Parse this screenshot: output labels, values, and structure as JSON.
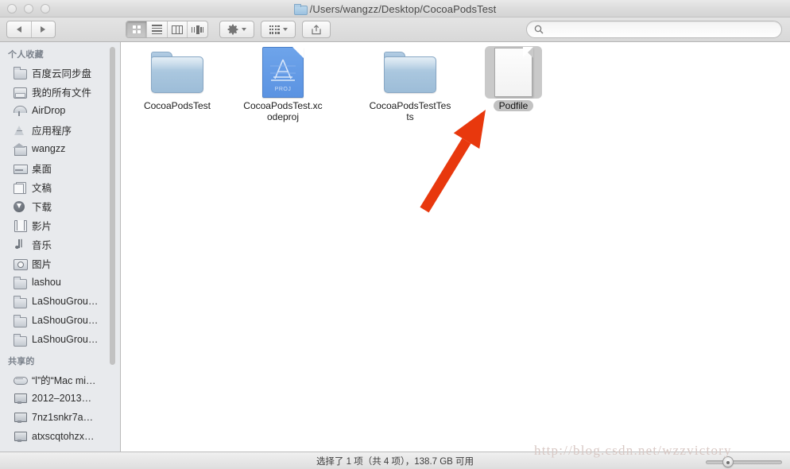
{
  "window": {
    "title": "/Users/wangzz/Desktop/CocoaPodsTest",
    "controls": {
      "close": "close-button",
      "minimize": "minimize-button",
      "maximize": "maximize-button"
    }
  },
  "toolbar": {
    "back_label": "◀",
    "forward_label": "▶",
    "view_modes": [
      {
        "name": "icon-view",
        "active": true
      },
      {
        "name": "list-view",
        "active": false
      },
      {
        "name": "column-view",
        "active": false
      },
      {
        "name": "coverflow-view",
        "active": false
      }
    ],
    "action_button": "gear-icon",
    "arrange_button": "arrange-icon",
    "share_button": "share-icon"
  },
  "search": {
    "value": "",
    "placeholder": "",
    "icon": "search-icon"
  },
  "sidebar": {
    "groups": [
      {
        "title": "个人收藏",
        "items": [
          {
            "label": "百度云同步盘",
            "icon": "folder-icon"
          },
          {
            "label": "我的所有文件",
            "icon": "all-files-icon"
          },
          {
            "label": "AirDrop",
            "icon": "airdrop-icon"
          },
          {
            "label": "应用程序",
            "icon": "applications-icon"
          },
          {
            "label": "wangzz",
            "icon": "home-icon"
          },
          {
            "label": "桌面",
            "icon": "desktop-icon"
          },
          {
            "label": "文稿",
            "icon": "documents-icon"
          },
          {
            "label": "下载",
            "icon": "downloads-icon"
          },
          {
            "label": "影片",
            "icon": "movies-icon"
          },
          {
            "label": "音乐",
            "icon": "music-icon"
          },
          {
            "label": "图片",
            "icon": "pictures-icon"
          },
          {
            "label": "lashou",
            "icon": "folder-icon"
          },
          {
            "label": "LaShouGrou…",
            "icon": "folder-icon"
          },
          {
            "label": "LaShouGrou…",
            "icon": "folder-icon"
          },
          {
            "label": "LaShouGrou…",
            "icon": "folder-icon"
          }
        ]
      },
      {
        "title": "共享的",
        "items": [
          {
            "label": "“l”的“Mac mi…",
            "icon": "mac-mini-icon"
          },
          {
            "label": "2012–2013…",
            "icon": "screen-icon"
          },
          {
            "label": "7nz1snkr7a…",
            "icon": "screen-icon"
          },
          {
            "label": "atxscqtohzx…",
            "icon": "screen-icon"
          }
        ]
      }
    ]
  },
  "files": [
    {
      "name": "CocoaPodsTest",
      "kind": "folder",
      "selected": false
    },
    {
      "name": "CocoaPodsTest.xcodeproj",
      "kind": "xcodeproj",
      "selected": false,
      "badge": "PROJ"
    },
    {
      "name": "CocoaPodsTestTests",
      "kind": "folder",
      "selected": false
    },
    {
      "name": "Podfile",
      "kind": "document",
      "selected": true
    }
  ],
  "status": {
    "text": "选择了 1 项（共 4 项），138.7 GB 可用",
    "selected_count": 1,
    "total_count": 4,
    "free_space": "138.7 GB"
  },
  "zoom_slider": {
    "value": 25
  },
  "watermark": {
    "text": "http://blog.csdn.net/wzzvictory"
  },
  "annotation": {
    "arrow_color": "#e8380d",
    "points_to": "Podfile"
  },
  "colors": {
    "sidebar_bg": "#e8eaed",
    "content_bg": "#ffffff",
    "selection": "#c9c9c9",
    "folder_blue": "#a9c6de",
    "accent_red": "#e8380d"
  }
}
